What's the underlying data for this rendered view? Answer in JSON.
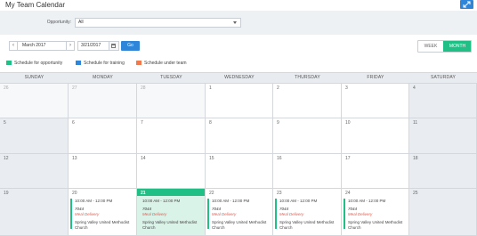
{
  "header": {
    "title": "My Team Calendar"
  },
  "filter": {
    "label": "Opportunity:",
    "value": "All"
  },
  "nav": {
    "prev": "‹",
    "month": "March 2017",
    "next": "›",
    "date_value": "3/21/2017",
    "go_label": "Go",
    "view_week": "WEEK",
    "view_month": "MONTH",
    "active_view": "MONTH"
  },
  "legend": [
    {
      "label": "Schedule for opportunity",
      "color": "#1fbf86"
    },
    {
      "label": "Schedule for training",
      "color": "#2f86d9"
    },
    {
      "label": "Schedule under team",
      "color": "#f07a4e"
    }
  ],
  "calendar": {
    "weekdays": [
      "SUNDAY",
      "MONDAY",
      "TUESDAY",
      "WEDNESDAY",
      "THURSDAY",
      "FRIDAY",
      "SATURDAY"
    ],
    "weeks": [
      [
        "26",
        "27",
        "28",
        "1",
        "2",
        "3",
        "4"
      ],
      [
        "5",
        "6",
        "7",
        "8",
        "9",
        "10",
        "11"
      ],
      [
        "12",
        "13",
        "14",
        "15",
        "16",
        "17",
        "18"
      ],
      [
        "19",
        "20",
        "21",
        "22",
        "23",
        "24",
        "25"
      ]
    ],
    "today": "21",
    "event": {
      "time": "10:00 AM - 12:00 PM",
      "code": "7044",
      "type": "Meal Delivery",
      "location": "Spring Valley United Methodist Church"
    }
  },
  "colors": {
    "accent_blue": "#2f86d9",
    "accent_green": "#1fbf86",
    "accent_orange": "#f07a4e"
  }
}
